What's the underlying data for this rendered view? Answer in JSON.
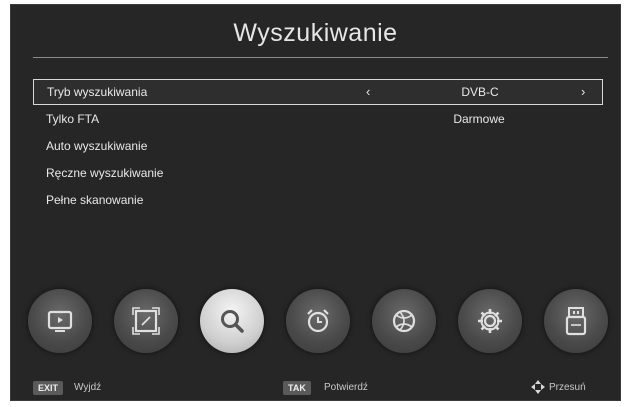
{
  "header": {
    "title": "Wyszukiwanie"
  },
  "menu": {
    "items": [
      {
        "label": "Tryb wyszukiwania",
        "value": "DVB-C",
        "left_arrow": "‹",
        "right_arrow": "›"
      },
      {
        "label": "Tylko FTA",
        "value": "Darmowe"
      },
      {
        "label": "Auto wyszukiwanie"
      },
      {
        "label": "Ręczne wyszukiwanie"
      },
      {
        "label": "Pełne skanowanie"
      }
    ]
  },
  "icon_bar": {
    "icons": [
      "tv-icon",
      "picture-icon",
      "search-icon",
      "alarm-clock-icon",
      "globe-icon",
      "settings-gear-icon",
      "usb-icon"
    ]
  },
  "footer": {
    "exit_key": "EXIT",
    "exit_label": "Wyjdź",
    "ok_key": "TAK",
    "ok_label": "Potwierdź",
    "move_label": "Przesuń"
  }
}
